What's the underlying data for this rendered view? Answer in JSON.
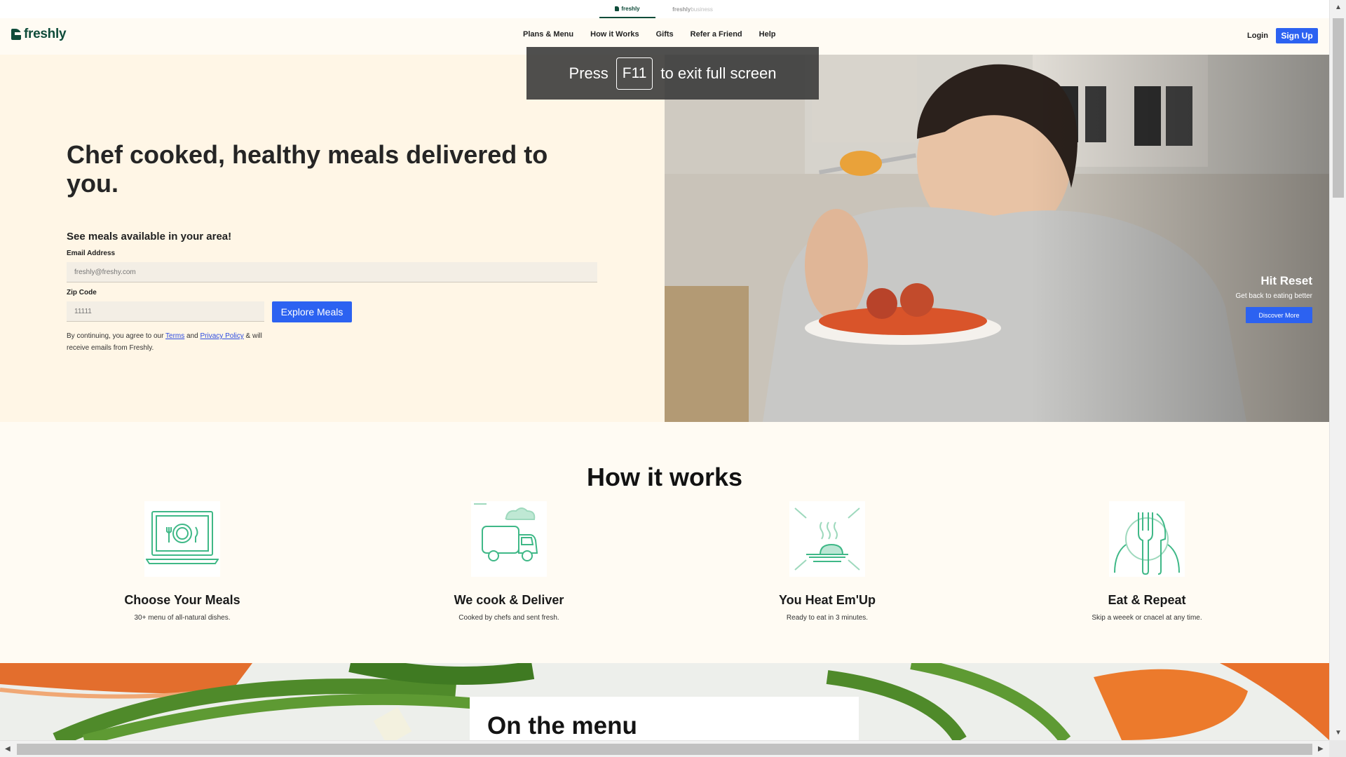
{
  "brand_switcher": {
    "freshly": "freshly",
    "business_bold": "freshly",
    "business_light": "business"
  },
  "nav": {
    "logo": "freshly",
    "links": [
      "Plans & Menu",
      "How it Works",
      "Gifts",
      "Refer a Friend",
      "Help"
    ],
    "login": "Login",
    "signup": "Sign Up"
  },
  "hero": {
    "title": "Chef cooked, healthy meals delivered to you.",
    "subtitle": "See meals available in your area!",
    "email_label": "Email Address",
    "email_placeholder": "freshly@freshy.com",
    "zip_label": "Zip Code",
    "zip_placeholder": "11111",
    "cta": "Explore Meals",
    "legal": {
      "prefix": "By continuing, you agree to our ",
      "terms": "Terms",
      "and": " and ",
      "privacy": "Privacy Policy",
      "suffix": " & will receive emails from Freshly."
    },
    "promo": {
      "title": "Hit Reset",
      "subtitle": "Get back to eating better",
      "button": "Discover More"
    }
  },
  "fullscreen_notice": {
    "press": "Press",
    "key": "F11",
    "rest": "to exit full screen"
  },
  "how_it_works": {
    "title": "How it works",
    "steps": [
      {
        "title": "Choose Your Meals",
        "desc": "30+ menu of all-natural dishes.",
        "icon": "laptop-plate-icon"
      },
      {
        "title": "We cook & Deliver",
        "desc": "Cooked by chefs and sent fresh.",
        "icon": "delivery-truck-icon"
      },
      {
        "title": "You Heat Em'Up",
        "desc": "Ready to eat in 3 minutes.",
        "icon": "microwave-icon"
      },
      {
        "title": "Eat & Repeat",
        "desc": "Skip a weeek or cnacel at any time.",
        "icon": "fork-knife-icon"
      }
    ]
  },
  "menu_section": {
    "title": "On the menu"
  },
  "colors": {
    "brand": "#0f4c3a",
    "accent": "#2c62f1",
    "icon": "#3fb887"
  }
}
